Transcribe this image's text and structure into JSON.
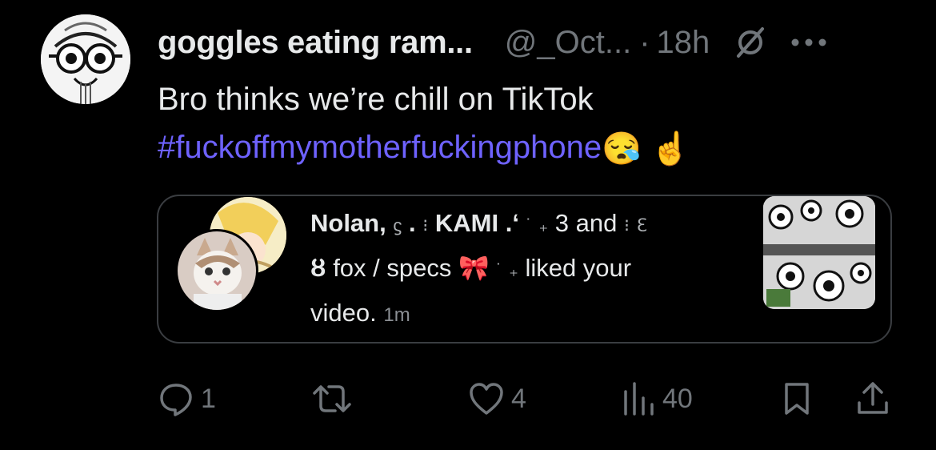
{
  "post": {
    "author_name": "goggles eating ram...",
    "handle": "@_Oct...",
    "separator": "·",
    "time": "18h",
    "text_line1": "Bro thinks we’re chill on TikTok",
    "hashtag": "#fuckoffmymotherfuckingphone",
    "emoji_1": "😪",
    "emoji_2": "☝️"
  },
  "card": {
    "name_1": "Nolan,",
    "name_2": "KAMI",
    "and_text": "3 and",
    "name_3": "fox / specs",
    "bow_emoji": "🎀",
    "liked_text": "liked your",
    "video_text": "video.",
    "time": "1m",
    "sym_1": "ϛ",
    "sym_2": ".",
    "sym_3": "⁝",
    "sym_4": ".ʻ",
    "sym_5": "˙",
    "sym_6": "₊",
    "sym_7": "⁝",
    "sym_8": "ȣ",
    "sym_9": "ℇ",
    "sym_10": "˙",
    "sym_11": "₊"
  },
  "actions": {
    "replies": "1",
    "reposts": "",
    "likes": "4",
    "views": "40"
  },
  "icons": {
    "mute": "no-notifications-icon",
    "more": "more-icon",
    "reply": "reply-icon",
    "repost": "repost-icon",
    "like": "heart-icon",
    "views": "views-icon",
    "bookmark": "bookmark-icon",
    "share": "share-icon"
  },
  "colors": {
    "background": "#000000",
    "text": "#e7e9ea",
    "secondary": "#71767b",
    "hashtag": "#6e62ff",
    "card_border": "#3a3d41"
  }
}
